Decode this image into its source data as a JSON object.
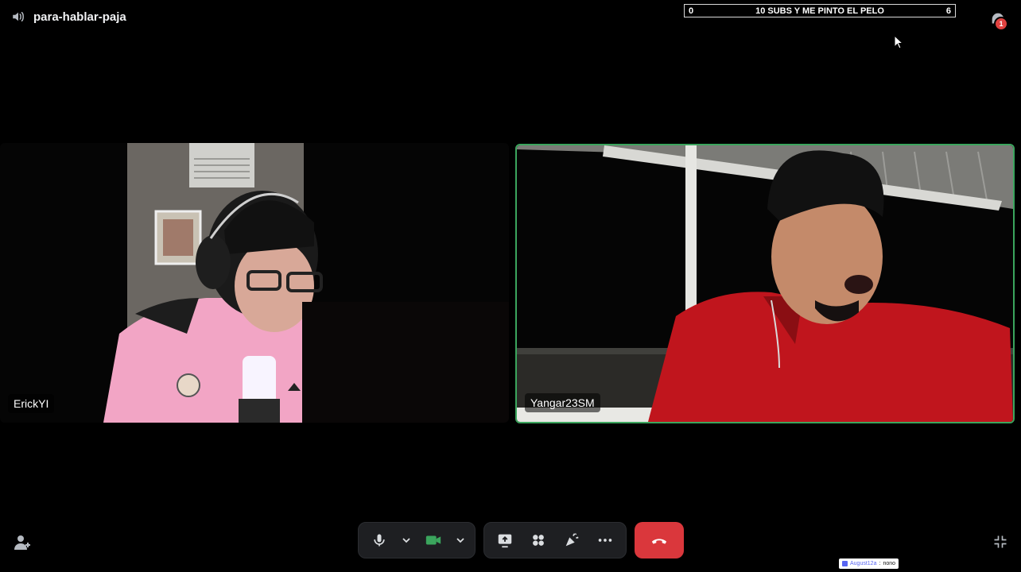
{
  "channel": {
    "name": "para-hablar-paja",
    "icon": "speaker-icon"
  },
  "goal": {
    "current": "0",
    "title": "10 SUBS Y ME PINTO EL PELO",
    "target": "6"
  },
  "inbox": {
    "icon": "inbox-icon",
    "badge": "1"
  },
  "participants": [
    {
      "name": "ErickYI",
      "speaking": false
    },
    {
      "name": "Yangar23SM",
      "speaking": true,
      "speaking_color": "#3ba55d"
    }
  ],
  "controls": {
    "mic": "microphone-icon",
    "camera": "camera-icon",
    "camera_active_color": "#3ba55d",
    "screenshare": "screen-share-icon",
    "activities": "activities-icon",
    "soundboard": "soundboard-icon",
    "more": "more-icon",
    "end_call": "end-call-icon",
    "end_call_color": "#da373c"
  },
  "chat_overlay": {
    "user": "August12a",
    "separator": ":",
    "message": "nono"
  }
}
